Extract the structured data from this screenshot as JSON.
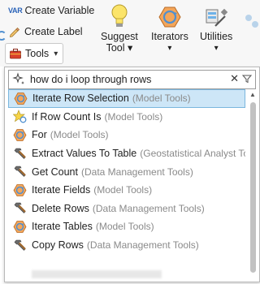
{
  "ribbon": {
    "variable": {
      "icon": "var-icon",
      "icon_text": "VAR",
      "label": "Create Variable"
    },
    "label_btn": {
      "icon": "pencil-label-icon",
      "label": "Create Label"
    },
    "tools_dropdown": {
      "icon": "toolbox-icon",
      "label": "Tools",
      "chevron": "▾"
    },
    "suggest": {
      "icon": "lightbulb-icon",
      "line1": "Suggest",
      "line2": "Tool ▾"
    },
    "iterators": {
      "icon": "iterator-icon",
      "label": "Iterators",
      "chevron": "▾"
    },
    "utilities": {
      "icon": "utilities-icon",
      "label": "Utilities",
      "chevron": "▾"
    }
  },
  "search": {
    "value": "how do i loop through rows",
    "clear_icon": "✕",
    "filter_icon": "filter-icon"
  },
  "results": [
    {
      "name": "Iterate Row Selection",
      "toolbox": "(Model Tools)",
      "icon": "iterator-icon",
      "selected": true
    },
    {
      "name": "If Row Count Is",
      "toolbox": "(Model Tools)",
      "icon": "logical-star-icon",
      "selected": false
    },
    {
      "name": "For",
      "toolbox": "(Model Tools)",
      "icon": "iterator-icon",
      "selected": false
    },
    {
      "name": "Extract Values To Table",
      "toolbox": "(Geostatistical Analyst Tools)",
      "icon": "hammer-icon",
      "selected": false
    },
    {
      "name": "Get Count",
      "toolbox": "(Data Management Tools)",
      "icon": "hammer-icon",
      "selected": false
    },
    {
      "name": "Iterate Fields",
      "toolbox": "(Model Tools)",
      "icon": "iterator-icon",
      "selected": false
    },
    {
      "name": "Delete Rows",
      "toolbox": "(Data Management Tools)",
      "icon": "hammer-icon",
      "selected": false
    },
    {
      "name": "Iterate Tables",
      "toolbox": "(Model Tools)",
      "icon": "iterator-icon",
      "selected": false
    },
    {
      "name": "Copy Rows",
      "toolbox": "(Data Management Tools)",
      "icon": "hammer-icon",
      "selected": false
    }
  ],
  "colors": {
    "selection_bg": "#cde6f7",
    "selection_border": "#7ab6de",
    "toolbox_text": "#8a8a8a",
    "accent": "#2a63b8"
  }
}
